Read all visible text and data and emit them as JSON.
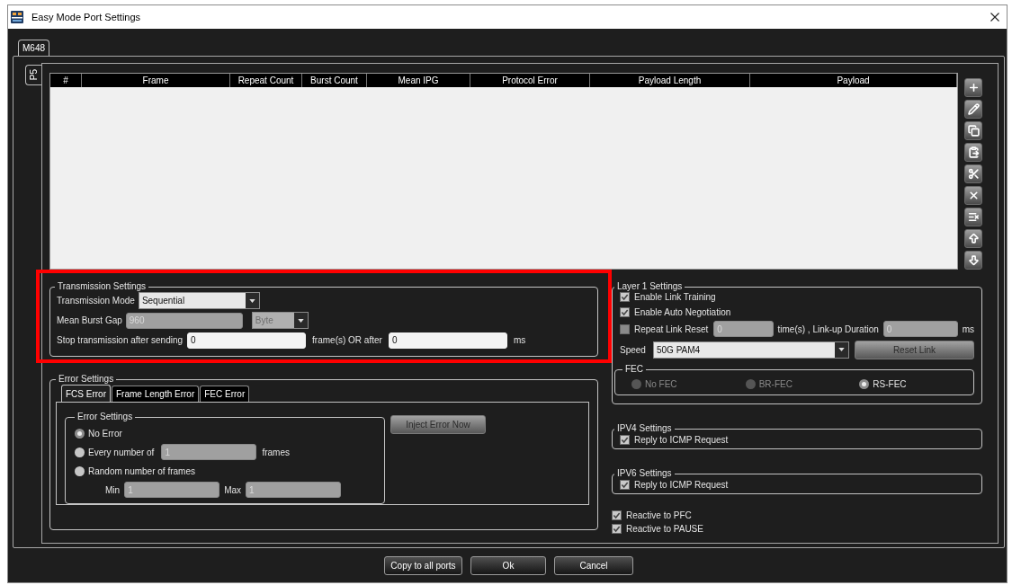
{
  "window": {
    "title": "Easy Mode Port Settings"
  },
  "module_tabs": [
    {
      "label": "M648",
      "selected": true
    }
  ],
  "port_tabs": [
    {
      "label": "P5",
      "selected": true
    }
  ],
  "frame_table": {
    "columns": [
      "#",
      "Frame",
      "Repeat Count",
      "Burst Count",
      "Mean IPG",
      "Protocol Error",
      "Payload Length",
      "Payload"
    ]
  },
  "transmission_settings": {
    "title": "Transmission Settings",
    "highlighted": true,
    "mode": {
      "label": "Transmission Mode",
      "value": "Sequential",
      "disabled": false
    },
    "burst_gap": {
      "label": "Mean Burst Gap",
      "value": "960",
      "disabled": true,
      "unit": {
        "value": "Byte",
        "disabled": true
      }
    },
    "stop": {
      "label": "Stop transmission after sending",
      "frames": {
        "value": "0",
        "disabled": false
      },
      "middle_label": "frame(s) OR after",
      "time": {
        "value": "0",
        "disabled": false
      },
      "unit": "ms"
    }
  },
  "error_settings": {
    "title": "Error Settings",
    "tabs": [
      {
        "label": "FCS Error",
        "selected": true
      },
      {
        "label": "Frame Length Error",
        "selected": false
      },
      {
        "label": "FEC Error",
        "selected": false
      }
    ],
    "group_title": "Error Settings",
    "options": [
      {
        "kind": "plain",
        "label": "No Error",
        "selected": true
      },
      {
        "kind": "count",
        "label": "Every number of",
        "selected": false,
        "field": {
          "value": "1",
          "disabled": true
        },
        "suffix": "frames"
      },
      {
        "kind": "range",
        "label": "Random number of frames",
        "selected": false,
        "min_label": "Min",
        "min": {
          "value": "1",
          "disabled": true
        },
        "max_label": "Max",
        "max": {
          "value": "1",
          "disabled": true
        }
      }
    ],
    "inject_button": {
      "label": "Inject Error Now",
      "disabled": true
    }
  },
  "layer1_settings": {
    "title": "Layer 1 Settings",
    "checks": [
      {
        "label": "Enable Link Training",
        "checked": true
      },
      {
        "label": "Enable Auto Negotiation",
        "checked": true
      }
    ],
    "repeat_link_reset": {
      "label": "Repeat Link Reset",
      "checked": false,
      "times": {
        "value": "0",
        "disabled": true
      },
      "middle_label": "time(s) , Link-up Duration",
      "duration": {
        "value": "0",
        "disabled": true
      },
      "unit": "ms"
    },
    "speed": {
      "label": "Speed",
      "value": "50G PAM4",
      "disabled": false
    },
    "reset_button": {
      "label": "Reset Link",
      "disabled": true
    },
    "fec": {
      "title": "FEC",
      "options": [
        {
          "label": "No FEC",
          "selected": false,
          "disabled": true
        },
        {
          "label": "BR-FEC",
          "selected": false,
          "disabled": true
        },
        {
          "label": "RS-FEC",
          "selected": true,
          "disabled": false
        }
      ]
    }
  },
  "ipv4_settings": {
    "title": "IPV4 Settings",
    "checks": [
      {
        "label": "Reply to ICMP Request",
        "checked": true
      }
    ]
  },
  "ipv6_settings": {
    "title": "IPV6 Settings",
    "checks": [
      {
        "label": "Reply to ICMP Request",
        "checked": true
      }
    ]
  },
  "reactive_checks": [
    {
      "label": "Reactive to PFC",
      "checked": true
    },
    {
      "label": "Reactive to PAUSE",
      "checked": true
    }
  ],
  "footer_buttons": [
    {
      "label": "Copy to all ports",
      "disabled": false
    },
    {
      "label": "Ok",
      "disabled": false
    },
    {
      "label": "Cancel",
      "disabled": false
    }
  ]
}
